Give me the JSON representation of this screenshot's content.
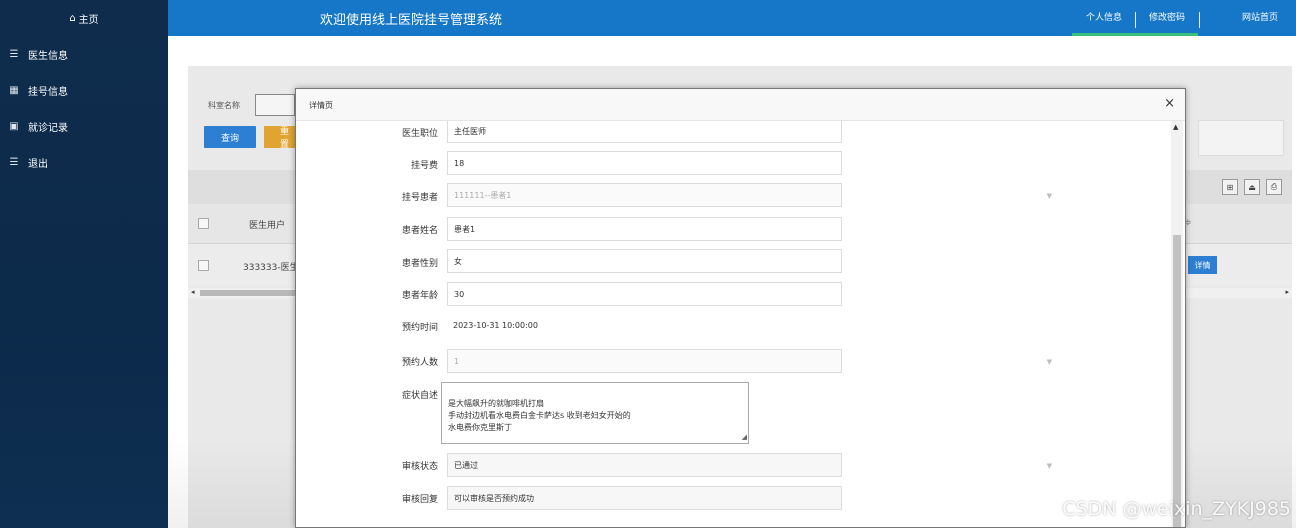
{
  "sidebar": {
    "home": {
      "icon": "home-icon",
      "label": "主页"
    },
    "items": [
      {
        "icon": "list-icon",
        "label": "医生信息"
      },
      {
        "icon": "grid-icon",
        "label": "挂号信息"
      },
      {
        "icon": "book-icon",
        "label": "就诊记录"
      },
      {
        "icon": "list-icon",
        "label": "退出"
      }
    ]
  },
  "topbar": {
    "title": "欢迎使用线上医院挂号管理系统",
    "profile": "个人信息",
    "password": "修改密码",
    "site_home": "网站首页",
    "accent_color": "#1677c9"
  },
  "search": {
    "label": "科室名称",
    "input_value": "",
    "query_button": "查询",
    "reset_button": "重置"
  },
  "toolbar": {
    "icons": [
      "delete-icon",
      "export-icon",
      "print-icon"
    ]
  },
  "table": {
    "header_doctor_user": "医生用户",
    "header_last_sort": "↕",
    "header_last": "≑",
    "rows": [
      {
        "doctor_user": "333333-医生",
        "detail_button": "详情"
      }
    ]
  },
  "modal": {
    "title": "详情页",
    "close": "×",
    "fields": {
      "doctor_title": {
        "label": "医生职位",
        "value": "主任医师"
      },
      "fee": {
        "label": "挂号费",
        "value": "18"
      },
      "patient": {
        "label": "挂号患者",
        "value": "111111--患者1"
      },
      "patient_name": {
        "label": "患者姓名",
        "value": "患者1"
      },
      "patient_gender": {
        "label": "患者性别",
        "value": "女"
      },
      "patient_age": {
        "label": "患者年龄",
        "value": "30"
      },
      "appointment_time": {
        "label": "预约时间",
        "value": "2023-10-31 10:00:00"
      },
      "appointment_count": {
        "label": "预约人数",
        "value": "1"
      },
      "symptoms": {
        "label": "症状自述",
        "value": "是大幅飙升的就咖啡机打扇\n手动封边机看水电费白金卡萨达s 收到老妇女开始的\n水电费你克里斯丁"
      },
      "review_status": {
        "label": "审核状态",
        "value": "已通过"
      },
      "review_reply": {
        "label": "审核回复",
        "value": "可以审核是否预约成功"
      }
    }
  },
  "watermark": "CSDN @weixin_ZYKJ985"
}
